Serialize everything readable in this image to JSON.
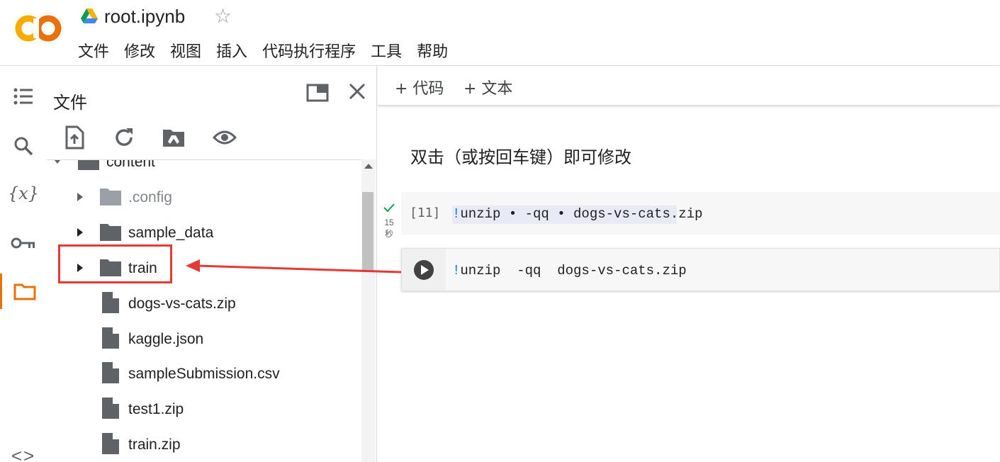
{
  "header": {
    "title": "root.ipynb",
    "logo_text": "CO",
    "menu": [
      "文件",
      "修改",
      "视图",
      "插入",
      "代码执行程序",
      "工具",
      "帮助"
    ]
  },
  "rail": {
    "items": [
      "toc-icon",
      "search-icon",
      "variables-icon",
      "key-icon",
      "folder-icon",
      "code-snippets-icon"
    ],
    "variables_glyph": "{x}",
    "code_glyph": "<>",
    "active": "folder-icon",
    "accent": "#e8710a"
  },
  "files_panel": {
    "title": "文件",
    "toolbar": [
      "upload-icon",
      "refresh-icon",
      "drive-folder-icon",
      "eye-icon"
    ],
    "tree": [
      {
        "name": "content",
        "type": "folder",
        "expanded": true
      },
      {
        "name": ".config",
        "type": "folder",
        "dim": true
      },
      {
        "name": "sample_data",
        "type": "folder"
      },
      {
        "name": "train",
        "type": "folder",
        "highlighted": true
      },
      {
        "name": "dogs-vs-cats.zip",
        "type": "file"
      },
      {
        "name": "kaggle.json",
        "type": "file"
      },
      {
        "name": "sampleSubmission.csv",
        "type": "file"
      },
      {
        "name": "test1.zip",
        "type": "file"
      },
      {
        "name": "train.zip",
        "type": "file"
      }
    ]
  },
  "notebook": {
    "add_code": "+ 代码",
    "add_text": "+ 文本",
    "text_cell": "双击（或按回车键）即可修改",
    "cells": [
      {
        "exec_count": "[11]",
        "time_value": "15",
        "time_unit": "秒",
        "code_bang": "!",
        "code_rest": "unzip • -qq • dogs-vs-cats.zip"
      },
      {
        "code_bang": "!",
        "code_rest": "unzip  -qq  dogs-vs-cats.zip"
      }
    ]
  },
  "colors": {
    "annotation_red": "#e53935",
    "drive_green": "#0f9d58",
    "drive_blue": "#4285f4",
    "drive_yellow": "#f4b400"
  }
}
